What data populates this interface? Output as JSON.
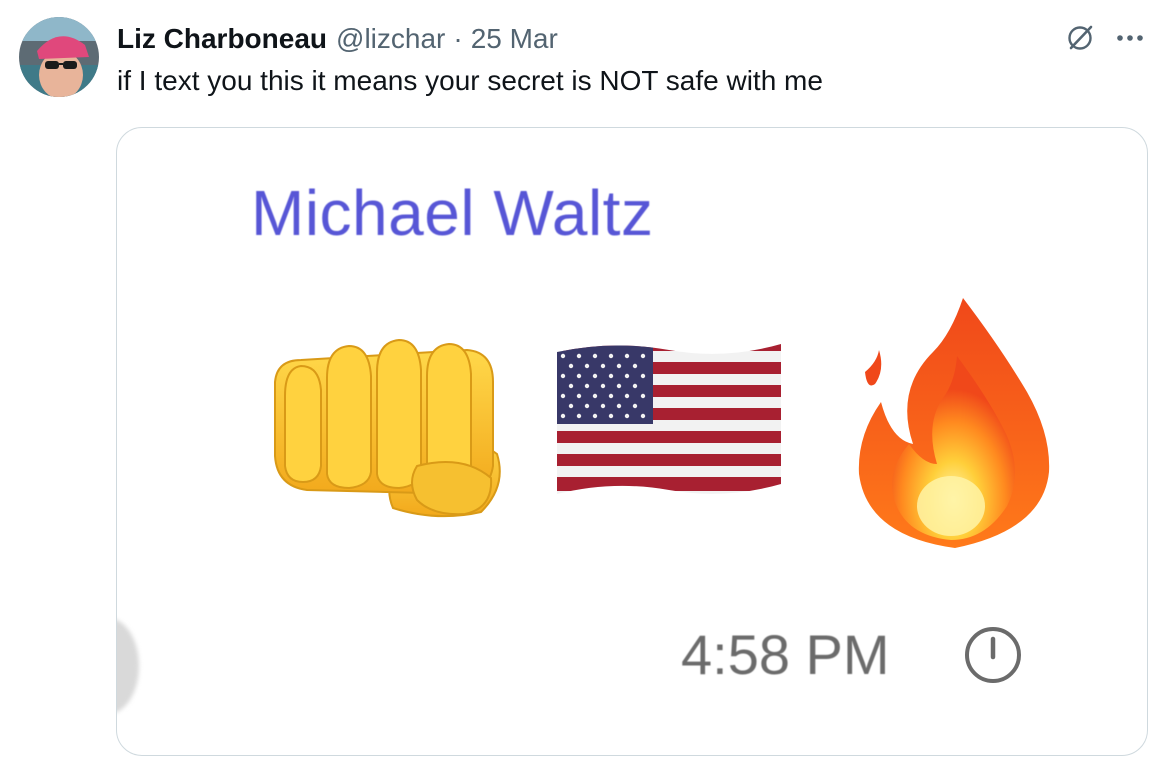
{
  "tweet": {
    "author": {
      "display_name": "Liz Charboneau",
      "handle": "@lizchar"
    },
    "separator": "·",
    "date": "25 Mar",
    "text": "if I text you this it means your secret is NOT safe with me",
    "actions": {
      "grok_icon": "grok-slash-icon",
      "more_icon": "more-dots-icon",
      "more_label": "···"
    }
  },
  "media": {
    "contact_name": "Michael Waltz",
    "emojis": [
      "oncoming-fist",
      "us-flag",
      "fire"
    ],
    "timestamp": "4:58 PM",
    "timestamp_icon": "clock-icon",
    "colors": {
      "contact_name": "#5756d6",
      "timestamp": "#6b6b6b"
    }
  }
}
